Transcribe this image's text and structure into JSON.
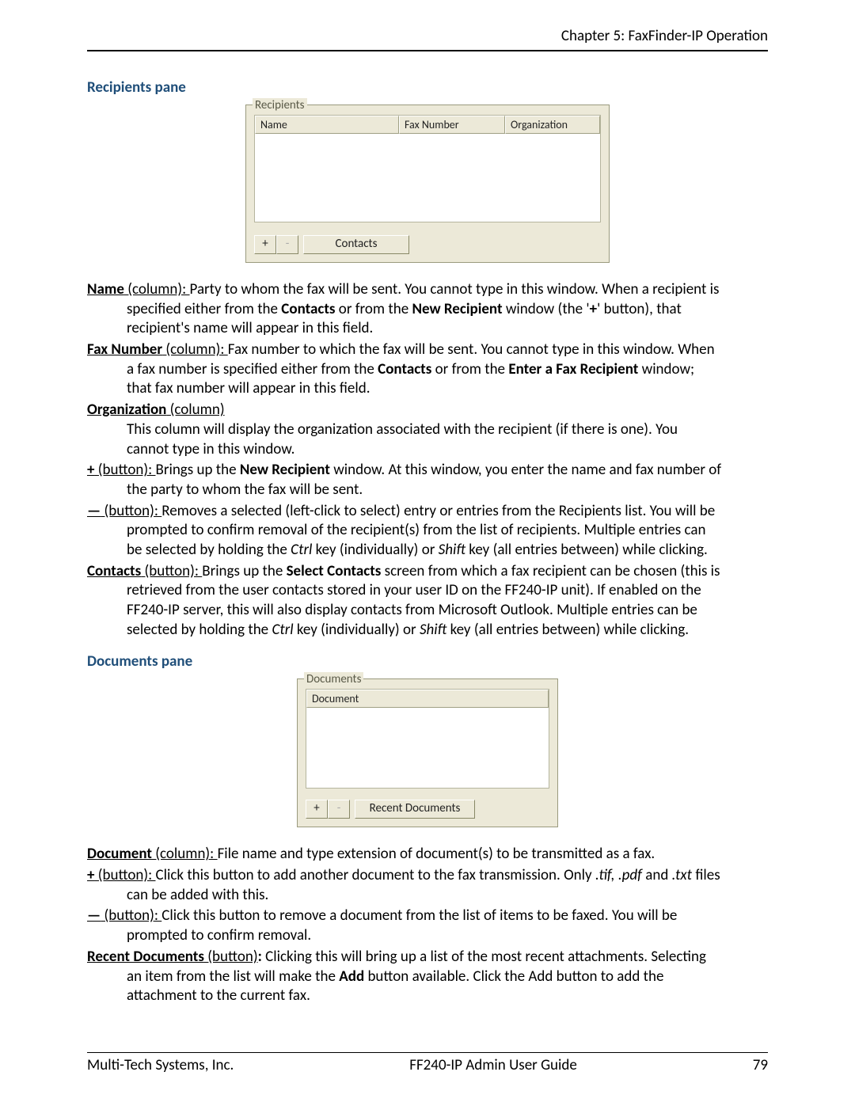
{
  "header": {
    "chapter": "Chapter 5: FaxFinder-IP Operation"
  },
  "sections": {
    "recipients_title": "Recipients pane",
    "documents_title": "Documents pane"
  },
  "recipients_pane": {
    "legend": "Recipients",
    "columns": {
      "name": "Name",
      "fax": "Fax Number",
      "org": "Organization"
    },
    "btn_plus": "+",
    "btn_minus": "-",
    "btn_contacts": "Contacts"
  },
  "documents_pane": {
    "legend": "Documents",
    "column": "Document",
    "btn_plus": "+",
    "btn_minus": "-",
    "btn_recent": "Recent Documents"
  },
  "recipients_desc": {
    "name": {
      "term": "Name",
      "label": " (column): ",
      "text_first": "Party to whom the fax will be sent. You cannot type in this window. When a recipient is",
      "line2a": "specified either from the ",
      "bold2a": "Contacts",
      "line2b": " or from the ",
      "bold2b": "New Recipient",
      "line2c": " window (the '",
      "bold2c": "+",
      "line2d": "' button), that",
      "line3": "recipient's name will appear in this field."
    },
    "fax": {
      "term": "Fax Number",
      "label": " (column): ",
      "text_first": "Fax number to which the fax will be sent. You cannot type in this window. When",
      "line2a": "a fax number is specified either from the ",
      "bold2a": "Contacts",
      "line2b": " or from the ",
      "bold2b": "Enter a Fax Recipient",
      "line2c": " window;",
      "line3": "that fax number will appear in this field."
    },
    "org": {
      "term": "Organization",
      "label": " (column)",
      "line2": "This column will display the organization associated with the recipient (if there is one). You",
      "line3": "cannot type in this window."
    },
    "plus": {
      "term": "+",
      "label": " (button): ",
      "text_first_a": "Brings up the ",
      "bold1": "New Recipient",
      "text_first_b": " window. At this window, you enter the name and fax number of",
      "line2": "the party to whom the fax will be sent."
    },
    "minus": {
      "term": "—",
      "label": " (button): ",
      "text_first": "Removes a selected (left-click to select) entry or entries from the Recipients list. You will be",
      "line2": "prompted to confirm removal of the recipient(s) from the list of recipients. Multiple entries can",
      "line3a": "be selected by holding the ",
      "it3a": "Ctrl",
      "line3b": " key (individually) or ",
      "it3b": "Shift",
      "line3c": " key (all entries between) while clicking."
    },
    "contacts": {
      "term": "Contacts",
      "label": " (button): ",
      "text_first_a": "Brings up the ",
      "bold1": "Select Contacts",
      "text_first_b": " screen from which a fax recipient can be chosen (this is",
      "line2": "retrieved from the user contacts stored in your user ID on the FF240-IP unit). If enabled on the",
      "line3": "FF240-IP server, this will also display contacts from Microsoft Outlook. Multiple entries can be",
      "line4a": "selected by holding the ",
      "it4a": "Ctrl",
      "line4b": " key (individually) or ",
      "it4b": "Shift",
      "line4c": " key (all entries between) while clicking."
    }
  },
  "documents_desc": {
    "doc": {
      "term": "Document",
      "label": " (column): ",
      "text": "File name and type extension of document(s) to be transmitted as a fax."
    },
    "plus": {
      "term": "+",
      "label": " (button): ",
      "text_a": "Click this button to add another document to the fax transmission. Only ",
      "it1": ".tif, .pdf",
      "text_b": " and ",
      "it2": ".txt",
      "text_c": " files",
      "line2": "can be added with this."
    },
    "minus": {
      "term": "—",
      "label": " (button): ",
      "text": "Click this button to remove a document from the list of items to be faxed. You will be",
      "line2": "prompted to confirm removal."
    },
    "recent": {
      "term": "Recent Documents",
      "label": " (button)",
      "boldcolon": ": ",
      "text": "Clicking this will bring up a list of the most recent attachments. Selecting",
      "line2a": "an item from the list will make the ",
      "bold2": "Add",
      "line2b": " button available. Click the Add button to add the",
      "line3": "attachment to the current fax."
    }
  },
  "footer": {
    "left": "Multi-Tech Systems, Inc.",
    "center": "FF240-IP Admin User Guide",
    "right": "79"
  }
}
